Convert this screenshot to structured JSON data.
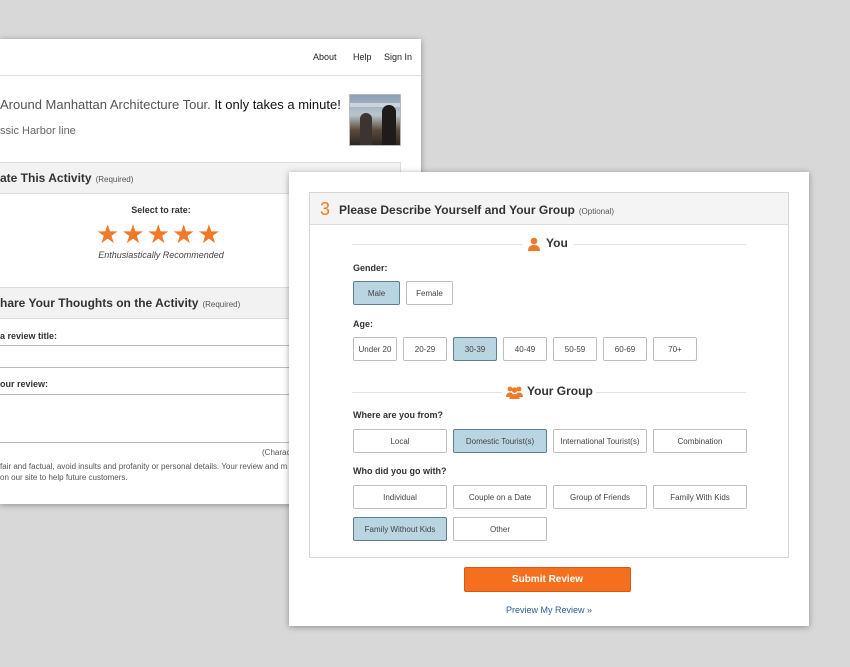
{
  "nav": {
    "about": "About",
    "help": "Help",
    "signin": "Sign In"
  },
  "intro": {
    "line1_start": "Around Manhattan Architecture Tour.",
    "line1_end": " It only takes a minute!",
    "line2": "ssic Harbor line"
  },
  "rate": {
    "title": "ate This Activity",
    "required": "(Required)",
    "select_label": "Select to rate:",
    "star_glyph": "★",
    "stars_filled": 5,
    "stars_total": 5,
    "rating_text": "Enthusiastically Recommended"
  },
  "thoughts": {
    "title": "hare Your Thoughts on the Activity",
    "required": "(Required)",
    "title_field_label": "a review title:",
    "review_field_label": "our review:",
    "char_note": "(Charac",
    "fine1": "fair and factual, avoid insults and profanity or personal details. Your review and m",
    "fine2": "on our site to help future customers."
  },
  "describe": {
    "step": "3",
    "title": "Please Describe Yourself and Your Group",
    "optional": "(Optional)",
    "you": "You",
    "your_group": "Your Group",
    "gender_label": "Gender:",
    "gender_options": [
      "Male",
      "Female"
    ],
    "gender_selected": "Male",
    "age_label": "Age:",
    "age_options": [
      "Under 20",
      "20-29",
      "30-39",
      "40-49",
      "50-59",
      "60-69",
      "70+"
    ],
    "age_selected": "30-39",
    "from_label": "Where are you from?",
    "from_options": [
      "Local",
      "Domestic Tourist(s)",
      "International Tourist(s)",
      "Combination"
    ],
    "from_selected": "Domestic Tourist(s)",
    "with_label": "Who did you go with?",
    "with_options": [
      "Individual",
      "Couple on a Date",
      "Group of Friends",
      "Family With Kids",
      "Family Without Kids",
      "Other"
    ],
    "with_selected": "Family Without Kids"
  },
  "actions": {
    "submit": "Submit Review",
    "preview": "Preview My Review »"
  },
  "colors": {
    "accent": "#f07a2a",
    "selected_bg": "#b9d5e2",
    "link": "#2a5f93"
  }
}
